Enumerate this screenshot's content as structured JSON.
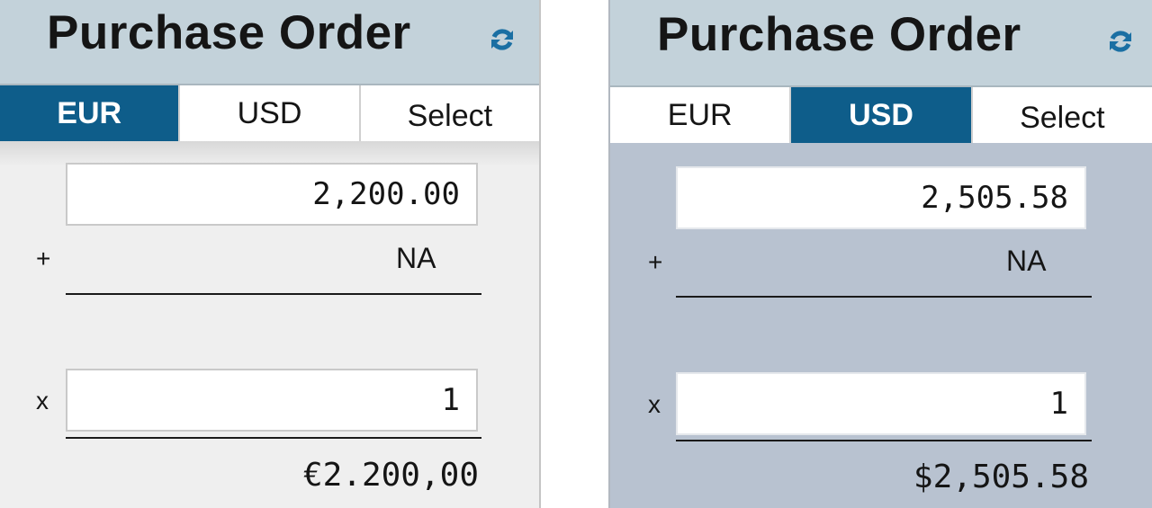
{
  "left": {
    "title": "Purchase Order",
    "tabs": [
      {
        "label": "EUR",
        "active": true
      },
      {
        "label": "USD",
        "active": false
      },
      {
        "label": "Select",
        "active": false
      }
    ],
    "amount_value": "2,200.00",
    "plus_symbol": "+",
    "addend_value": "NA",
    "multiply_symbol": "x",
    "quantity_value": "1",
    "total": "€2.200,00",
    "colors": {
      "active_tab": "#0e5d8a",
      "background": "#efefef",
      "header": "#c3d2da"
    }
  },
  "right": {
    "title": "Purchase Order",
    "tabs": [
      {
        "label": "EUR",
        "active": false
      },
      {
        "label": "USD",
        "active": true
      },
      {
        "label": "Select",
        "active": false
      }
    ],
    "amount_value": "2,505.58",
    "plus_symbol": "+",
    "addend_value": "NA",
    "multiply_symbol": "x",
    "quantity_value": "1",
    "total": "$2,505.58",
    "colors": {
      "active_tab": "#0e5d8a",
      "background": "#b8c2d0",
      "header": "#c3d2da"
    }
  },
  "icons": {
    "refresh": "refresh-icon"
  }
}
